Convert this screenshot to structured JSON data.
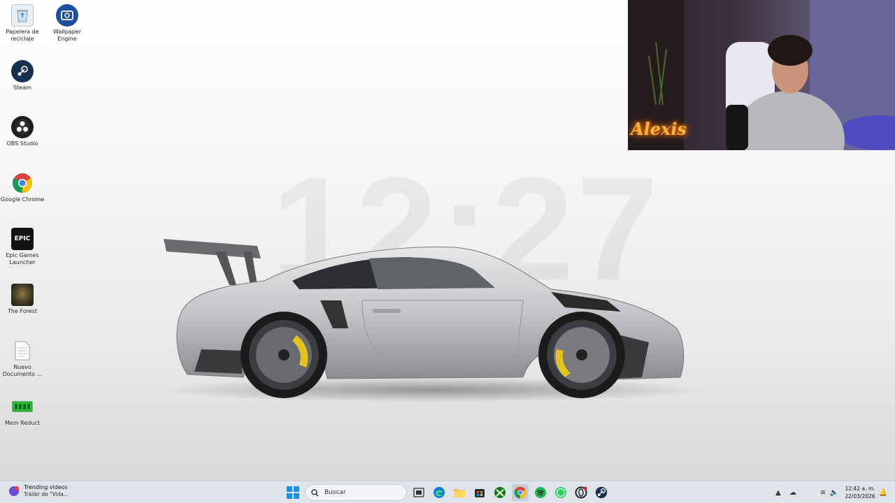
{
  "desktop": {
    "icons": [
      {
        "label": "Papelera de reciclaje",
        "icon": "recycle-bin-icon"
      },
      {
        "label": "Wallpaper Engine",
        "icon": "wallpaper-engine-icon"
      },
      {
        "label": "Steam",
        "icon": "steam-icon"
      },
      {
        "label": "OBS Studio",
        "icon": "obs-icon"
      },
      {
        "label": "Google Chrome",
        "icon": "chrome-icon"
      },
      {
        "label": "Epic Games Launcher",
        "icon": "epic-games-icon"
      },
      {
        "label": "The Forest",
        "icon": "the-forest-icon"
      },
      {
        "label": "Nuevo Documento ...",
        "icon": "document-icon"
      },
      {
        "label": "Mem Reduct",
        "icon": "mem-reduct-icon"
      }
    ],
    "clock": "12:27",
    "epic_icon_text": "EPIC"
  },
  "webcam": {
    "neon_sign": "Alexis"
  },
  "taskbar": {
    "news_title": "Trending videos",
    "news_subtitle": "Tráiler de \"Vida...",
    "search_placeholder": "Buscar",
    "apps": [
      "start-icon",
      "task-view-icon",
      "edge-icon",
      "file-explorer-icon",
      "store-icon",
      "xbox-icon",
      "chrome-icon",
      "spotify-icon",
      "whatsapp-icon",
      "opera-gx-icon",
      "steam-icon"
    ],
    "time": "12:42 a. m.",
    "date": "22/03/2026"
  },
  "colors": {
    "accent": "#0078d4",
    "taskbar_bg": "#dfe3ea"
  }
}
